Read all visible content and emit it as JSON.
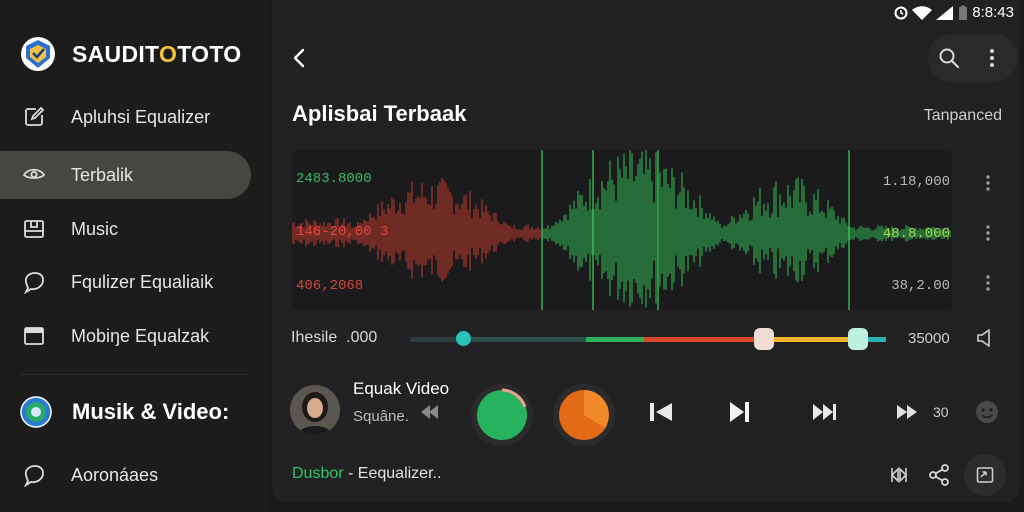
{
  "status": {
    "time": "8:8:43"
  },
  "brand": {
    "name_part1": "SAUDIT",
    "name_highlight": "O",
    "name_part2": "TOTO"
  },
  "sidebar": {
    "items": [
      {
        "label": "Apluhsi Equalizer",
        "icon": "edit-icon"
      },
      {
        "label": "Terbalik",
        "icon": "eye-icon",
        "active": true
      },
      {
        "label": "Music",
        "icon": "music-box-icon"
      },
      {
        "label": "Fqulizer Equaliaik",
        "icon": "chat-bubble-icon"
      },
      {
        "label": "Mobiŋe Equalzak",
        "icon": "window-icon"
      }
    ],
    "section": {
      "title": "Musik & Video:",
      "icon": "globe-icon"
    },
    "bottom_item": {
      "label": "Aoronáaes",
      "icon": "chat-bubble-icon"
    }
  },
  "main": {
    "title": "Aplisbai Terbaak",
    "sort_label": "Tanpanced",
    "waveform": {
      "left_labels": [
        {
          "text": "2483.8000",
          "color": "#3fb761"
        },
        {
          "text": "146-20,00 3",
          "color": "#e8453b"
        },
        {
          "text": "406,2068",
          "color": "#d4463a"
        }
      ],
      "right_labels": [
        {
          "text": "1.18,000",
          "color": "#b9b9b9"
        },
        {
          "text": "48.8.000",
          "color": "#a6d94a"
        },
        {
          "text": "38,2.00",
          "color": "#b9b9b9"
        }
      ]
    },
    "slider": {
      "label": "Ihesile",
      "start_value": ".000",
      "end_value": "35000"
    },
    "now_playing": {
      "title": "Equak Video",
      "subtitle": "Squâne."
    },
    "speed_label": "30",
    "footer": {
      "accent": "Dusbor",
      "text": " - Eequalizer.."
    }
  },
  "colors": {
    "accent_green": "#2fb35a",
    "accent_orange": "#e36a17",
    "track_teal": "#2bb3ad",
    "track_red": "#d9482f",
    "track_yellow": "#f0b52b"
  }
}
